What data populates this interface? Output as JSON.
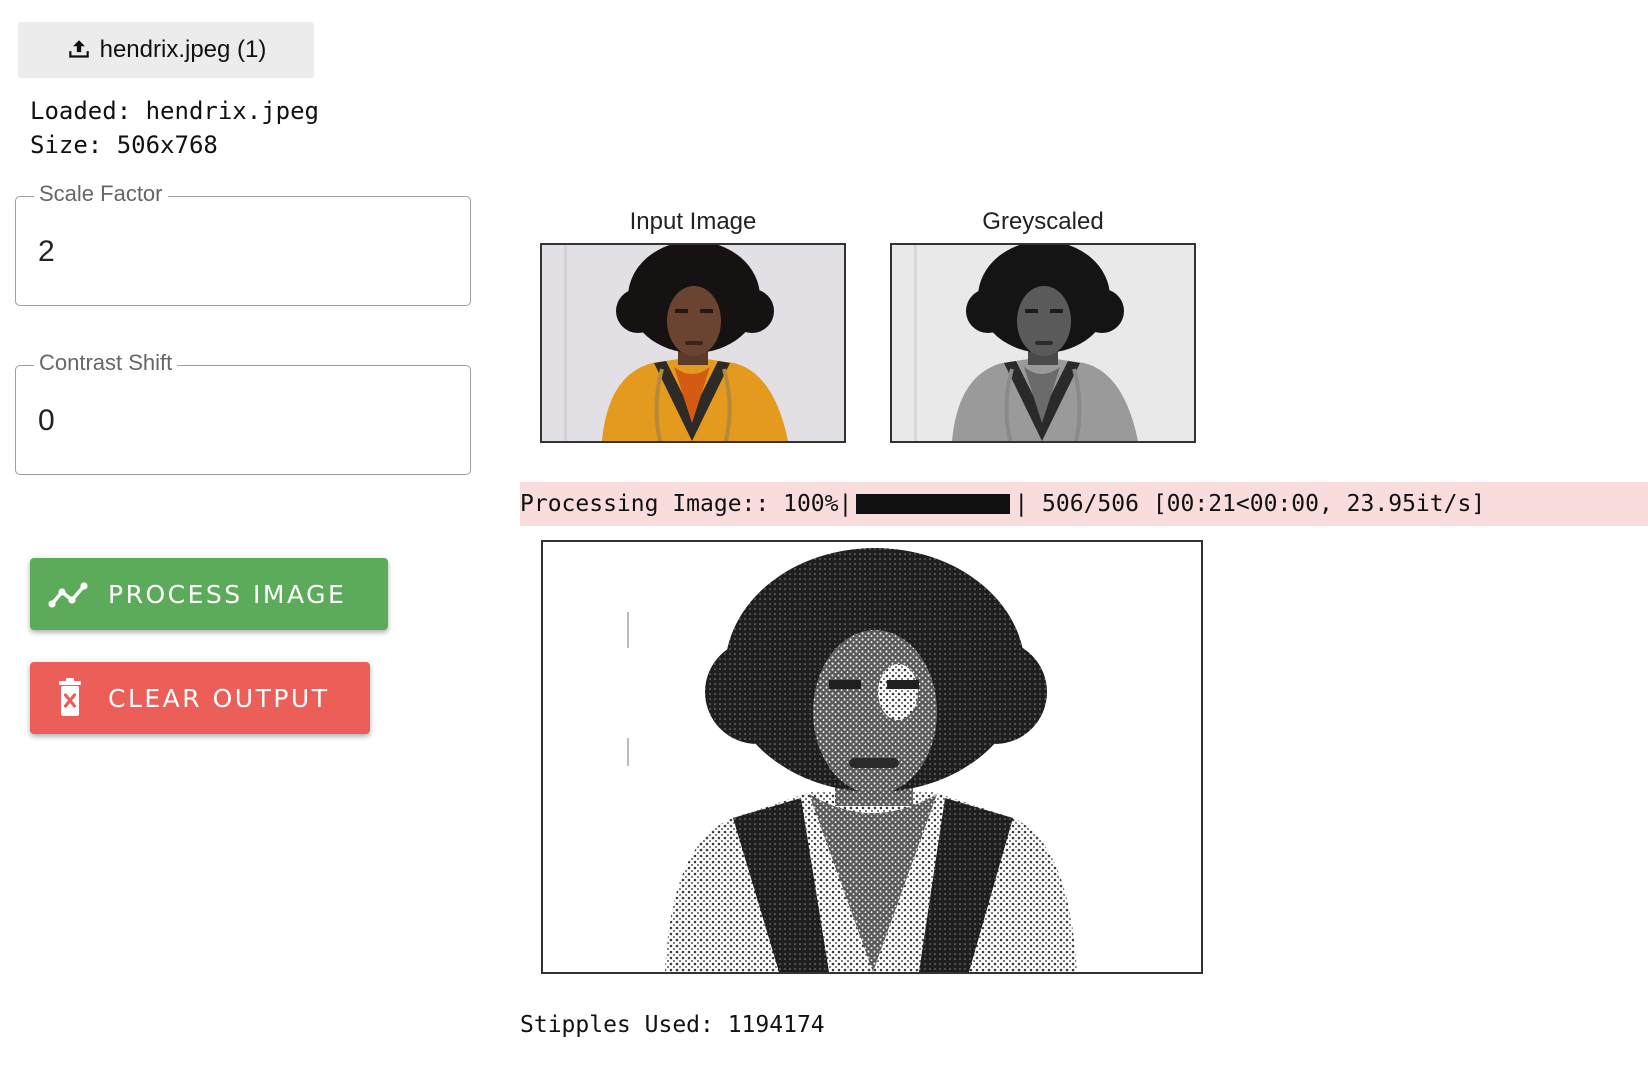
{
  "upload": {
    "label": "hendrix.jpeg (1)"
  },
  "info": {
    "loaded": "Loaded: hendrix.jpeg",
    "size": "Size: 506x768"
  },
  "fields": {
    "scale": {
      "label": "Scale Factor",
      "value": "2"
    },
    "contrast": {
      "label": "Contrast Shift",
      "value": "0"
    }
  },
  "buttons": {
    "process": {
      "label": "PROCESS IMAGE",
      "color": "#5cab5a"
    },
    "clear": {
      "label": "CLEAR OUTPUT",
      "color": "#ec5e58"
    }
  },
  "plots": {
    "input_title": "Input Image",
    "grey_title": "Greyscaled"
  },
  "progress": {
    "prefix": "Processing Image:: 100%|",
    "suffix": "| 506/506 [00:21<00:00, 23.95it/s]",
    "fraction": 1.0
  },
  "stipples": {
    "text": "Stipples Used: 1194174"
  },
  "icons": {
    "upload": "upload-icon",
    "process": "chart-line-icon",
    "clear": "trash-icon"
  }
}
